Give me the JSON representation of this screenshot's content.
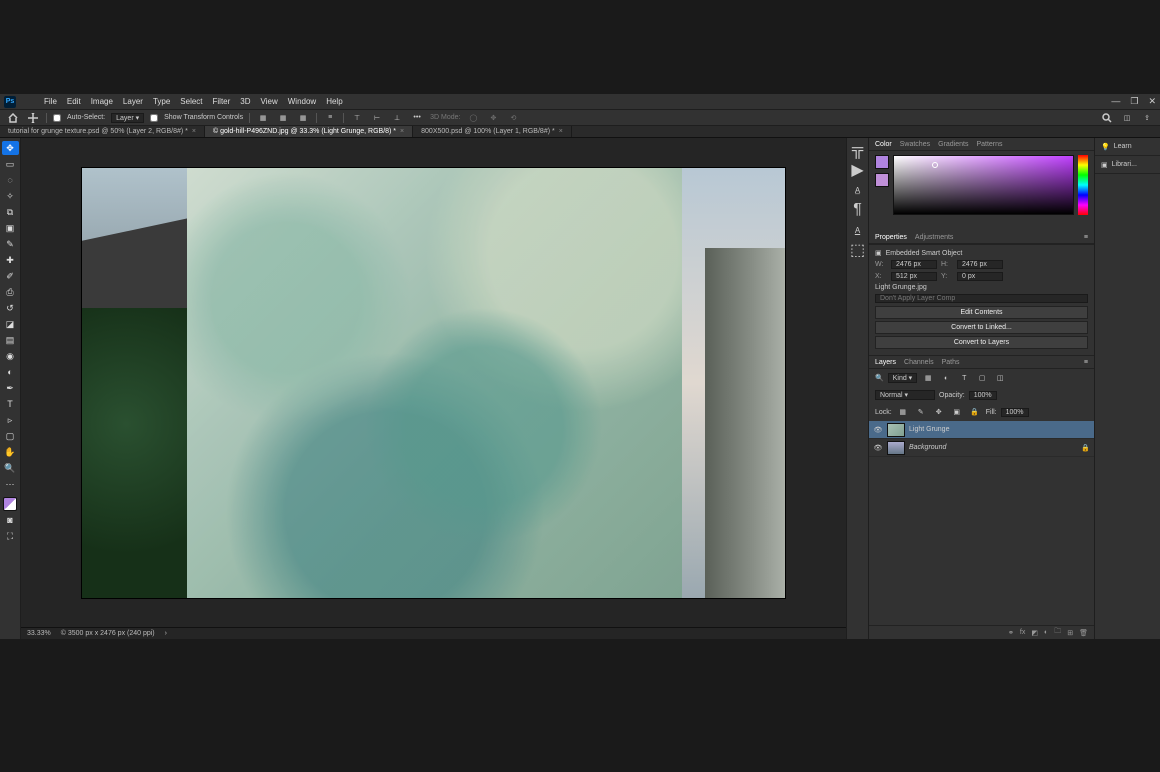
{
  "app": {
    "logo": "Ps"
  },
  "menu": [
    "File",
    "Edit",
    "Image",
    "Layer",
    "Type",
    "Select",
    "Filter",
    "3D",
    "View",
    "Window",
    "Help"
  ],
  "options": {
    "auto_select": "Auto-Select:",
    "auto_select_target": "Layer",
    "show_transform": "Show Transform Controls",
    "mode_3d": "3D Mode:"
  },
  "tabs": [
    {
      "label": "tutorial for grunge texture.psd @ 50% (Layer 2, RGB/8#) *",
      "active": false
    },
    {
      "label": "© gold-hill-P496ZND.jpg @ 33.3% (Light Grunge, RGB/8) *",
      "active": true
    },
    {
      "label": "800X500.psd @ 100% (Layer 1, RGB/8#) *",
      "active": false
    }
  ],
  "status": {
    "zoom": "33.33%",
    "dims": "© 3500 px x 2476 px (240 ppi)"
  },
  "color_panel": {
    "tabs": [
      "Color",
      "Swatches",
      "Gradients",
      "Patterns"
    ]
  },
  "properties": {
    "tabs": [
      "Properties",
      "Adjustments"
    ],
    "type": "Embedded Smart Object",
    "W": "2476 px",
    "H": "2476 px",
    "X": "512 px",
    "Y": "0 px",
    "filename": "Light Grunge.jpg",
    "layercomp": "Don't Apply Layer Comp",
    "btn_edit": "Edit Contents",
    "btn_linked": "Convert to Linked...",
    "btn_layers": "Convert to Layers"
  },
  "layers": {
    "tabs": [
      "Layers",
      "Channels",
      "Paths"
    ],
    "kind": "Kind",
    "blend": "Normal",
    "opacity_lbl": "Opacity:",
    "opacity": "100%",
    "lock_lbl": "Lock:",
    "fill_lbl": "Fill:",
    "fill": "100%",
    "items": [
      {
        "name": "Light Grunge",
        "selected": true,
        "locked": false,
        "thumb": "tx"
      },
      {
        "name": "Background",
        "selected": false,
        "locked": true,
        "thumb": "bg"
      }
    ]
  },
  "right_tabs": [
    "Learn",
    "Librari..."
  ]
}
